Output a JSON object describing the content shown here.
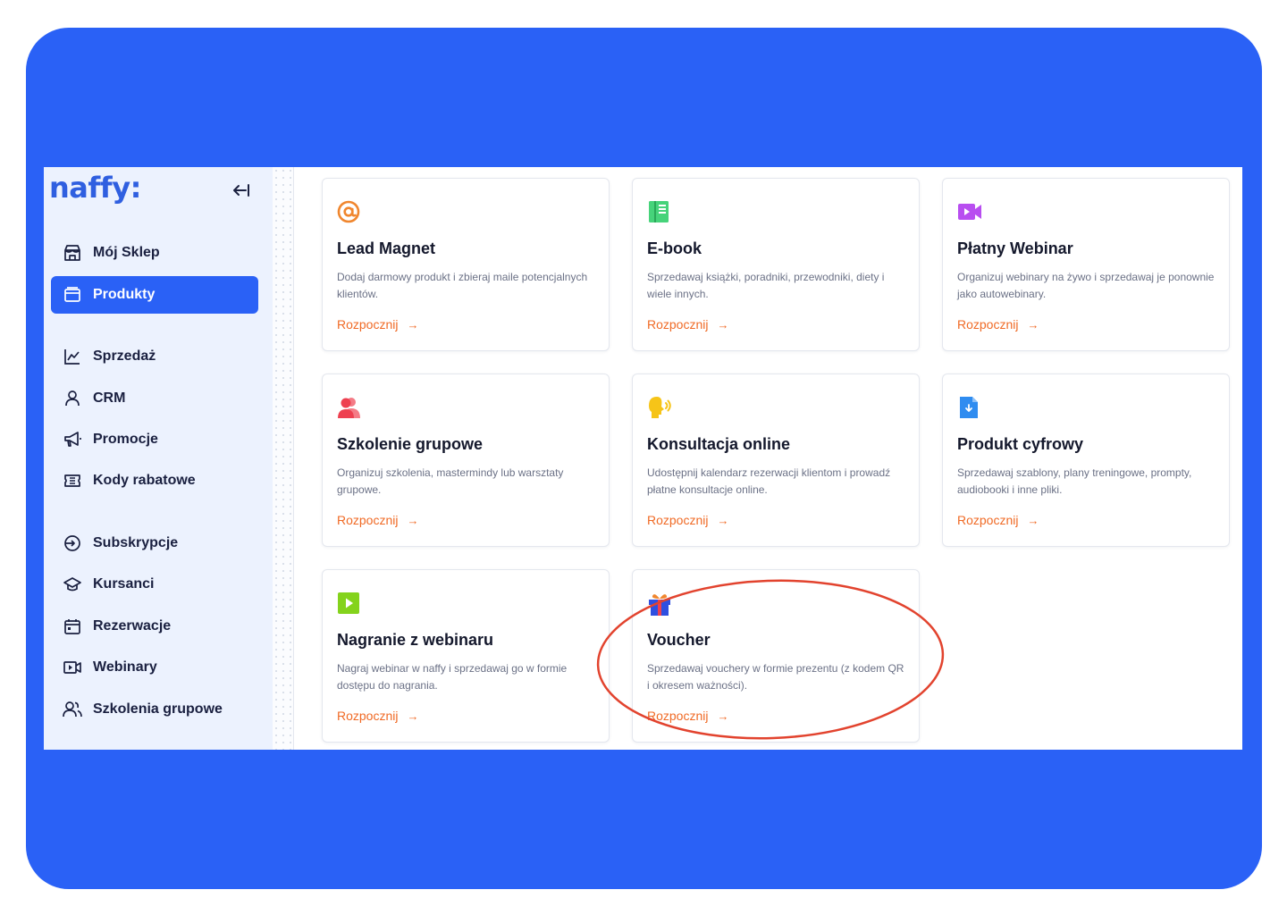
{
  "brand": {
    "logo_text": "naffy:",
    "accent": "#2a61f6",
    "cta_color": "#f06a25",
    "highlight": "#e2432e"
  },
  "sidebar": {
    "collapse_icon": "collapse-left-icon",
    "items": [
      {
        "label": "Mój Sklep",
        "icon": "store-icon",
        "active": false
      },
      {
        "label": "Produkty",
        "icon": "folder-icon",
        "active": true
      },
      {
        "label": "Sprzedaż",
        "icon": "chart-line-icon",
        "active": false
      },
      {
        "label": "CRM",
        "icon": "user-icon",
        "active": false
      },
      {
        "label": "Promocje",
        "icon": "megaphone-icon",
        "active": false
      },
      {
        "label": "Kody rabatowe",
        "icon": "ticket-icon",
        "active": false
      },
      {
        "label": "Subskrypcje",
        "icon": "subscription-icon",
        "active": false
      },
      {
        "label": "Kursanci",
        "icon": "graduation-cap-icon",
        "active": false
      },
      {
        "label": "Rezerwacje",
        "icon": "calendar-icon",
        "active": false
      },
      {
        "label": "Webinary",
        "icon": "video-icon",
        "active": false
      },
      {
        "label": "Szkolenia grupowe",
        "icon": "users-icon",
        "active": false
      }
    ]
  },
  "products": [
    {
      "title": "Lead Magnet",
      "desc": "Dodaj darmowy produkt i zbieraj maile potencjalnych klientów.",
      "cta": "Rozpocznij",
      "icon": "at-sign-icon",
      "icon_color": "#f0862e"
    },
    {
      "title": "E-book",
      "desc": "Sprzedawaj książki, poradniki, przewodniki, diety i wiele innych.",
      "cta": "Rozpocznij",
      "icon": "book-icon",
      "icon_color": "#46d37a"
    },
    {
      "title": "Płatny Webinar",
      "desc": "Organizuj webinary na żywo i sprzedawaj je ponownie jako autowebinary.",
      "cta": "Rozpocznij",
      "icon": "video-camera-icon",
      "icon_color": "#b84ef0"
    },
    {
      "title": "Szkolenie grupowe",
      "desc": "Organizuj szkolenia, mastermindy lub warsztaty grupowe.",
      "cta": "Rozpocznij",
      "icon": "group-icon",
      "icon_color": "#ee4050"
    },
    {
      "title": "Konsultacja online",
      "desc": "Udostępnij kalendarz rezerwacji klientom i prowadź płatne konsultacje online.",
      "cta": "Rozpocznij",
      "icon": "speaking-head-icon",
      "icon_color": "#f6c418"
    },
    {
      "title": "Produkt cyfrowy",
      "desc": "Sprzedawaj szablony, plany treningowe, prompty, audiobooki i inne pliki.",
      "cta": "Rozpocznij",
      "icon": "file-download-icon",
      "icon_color": "#2f8cf0"
    },
    {
      "title": "Nagranie z webinaru",
      "desc": "Nagraj webinar w naffy i sprzedawaj go w formie dostępu do nagrania.",
      "cta": "Rozpocznij",
      "icon": "play-icon",
      "icon_color": "#84d31c"
    },
    {
      "title": "Voucher",
      "desc": "Sprzedawaj vouchery w formie prezentu (z kodem QR i okresem ważności).",
      "cta": "Rozpocznij",
      "icon": "gift-icon",
      "icon_color": "#2f4fe0"
    }
  ],
  "arrow_glyph": "→"
}
